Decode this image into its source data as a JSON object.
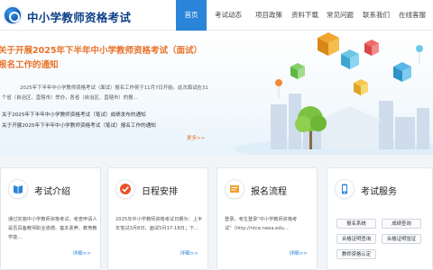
{
  "header": {
    "site_title": "中小学教师资格考试",
    "nav": [
      "首页",
      "考试动态",
      "项目政策",
      "资料下载",
      "常见问题",
      "联系我们",
      "在线客服"
    ],
    "active_index": 0
  },
  "banner": {
    "news_title": "关于开展2025年下半年中小学教师资格考试（面试）报名工作的通知",
    "summary": "2025年下半年中小学教师资格考试（面试）报名工作将于11月7日开始。此次面试在31个省（自治区、直辖市）举办，各省（自治区、直辖市）的报...",
    "sub_news": [
      "关于2025年下半年中小学教师资格考试（笔试）成绩发布的通知",
      "关于开展2025年下半年中小学教师资格考试（笔试）报名工作的通知"
    ],
    "more": "更多>>",
    "slide_count": 3,
    "active_slide": 0
  },
  "cards": [
    {
      "title": "考试介绍",
      "icon": "book-icon",
      "color": "#2a84d8",
      "text": "通过实施中小学教师资格考试，考查申请人是否具备教师职业道德、基本素养、教育教学能...",
      "more": "详细>>"
    },
    {
      "title": "日程安排",
      "icon": "checkmark-icon",
      "color": "#e8552a",
      "text": "2025年中小学教师资格考试日期为：上半年笔试3月8日，面试5月17-18日；下...",
      "more": "详细>>"
    },
    {
      "title": "报名流程",
      "icon": "certificate-icon",
      "color": "#f0a02a",
      "text": "登录。考生登录\"中小学教师资格考试\"（http://ntce.neea.edu...",
      "more": "详细>>"
    },
    {
      "title": "考试服务",
      "icon": "phone-icon",
      "color": "#2a84d8",
      "buttons": [
        "报名系统",
        "成绩查询",
        "合格证明查询",
        "合格证明验证",
        "教师资格认定"
      ]
    }
  ]
}
